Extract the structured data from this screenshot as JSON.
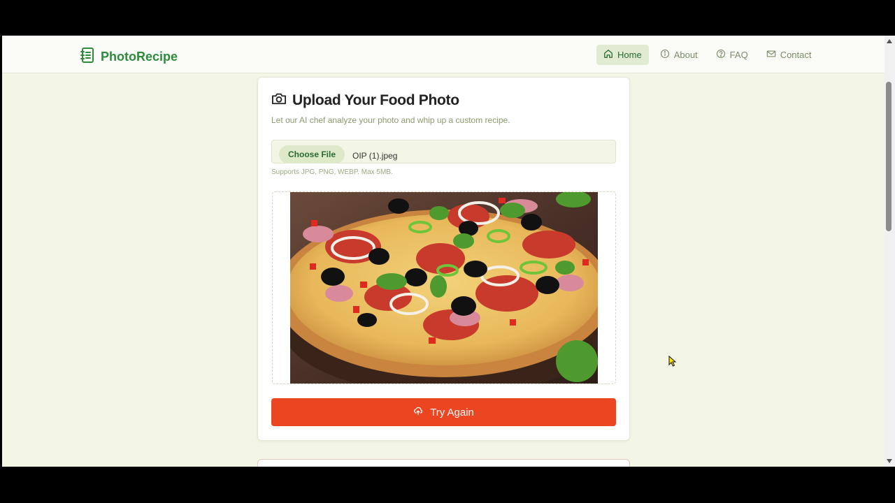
{
  "app": {
    "name": "PhotoRecipe",
    "logo_icon": "notebook-icon"
  },
  "nav": {
    "items": [
      {
        "label": "Home",
        "icon": "home-icon",
        "active": true
      },
      {
        "label": "About",
        "icon": "info-icon",
        "active": false
      },
      {
        "label": "FAQ",
        "icon": "help-circle-icon",
        "active": false
      },
      {
        "label": "Contact",
        "icon": "mail-icon",
        "active": false
      }
    ]
  },
  "upload": {
    "title": "Upload Your Food Photo",
    "title_icon": "camera-icon",
    "subtitle": "Let our AI chef analyze your photo and whip up a custom recipe.",
    "choose_file_label": "Choose File",
    "file_name": "OIP (1).jpeg",
    "hint": "Supports JPG, PNG, WEBP. Max 5MB.",
    "preview_image": "pizza-photo",
    "try_again_label": "Try Again",
    "try_again_icon": "cloud-upload-icon"
  },
  "colors": {
    "brand": "#2e8b3d",
    "page_background": "#f3f6e4",
    "primary_button": "#ec4521",
    "active_nav_bg": "#e1ebd2"
  }
}
